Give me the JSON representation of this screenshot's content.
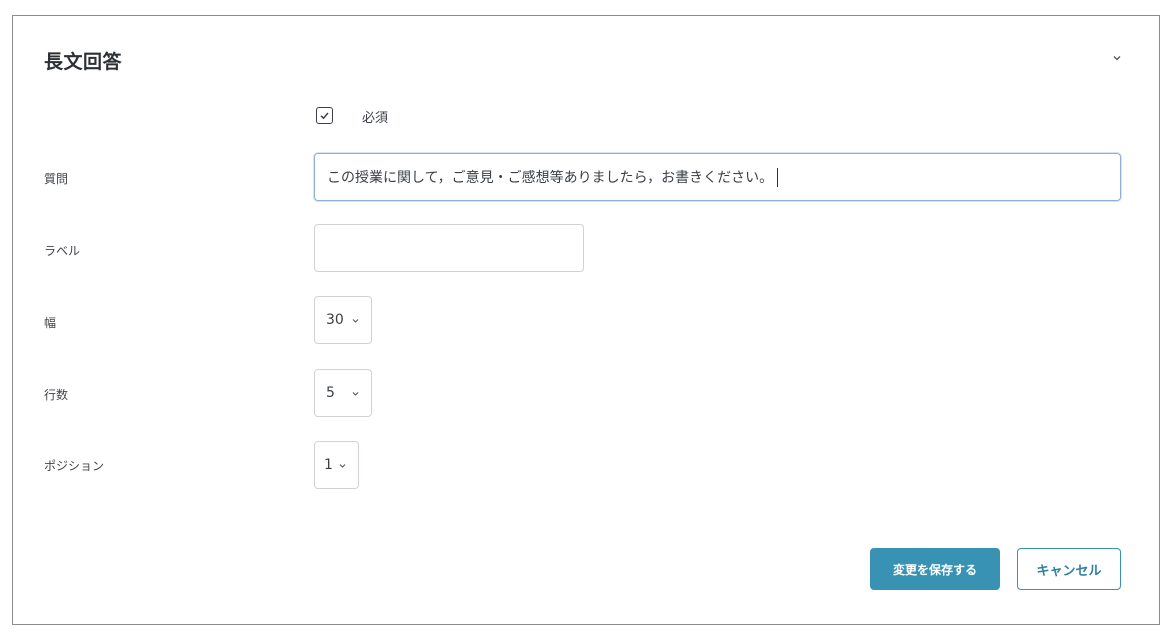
{
  "header": {
    "title": "長文回答",
    "collapse_icon": "chevron-down-icon"
  },
  "required": {
    "checked": true,
    "label": "必須"
  },
  "fields": {
    "question": {
      "label": "質問",
      "value": "この授業に関して，ご意見・ご感想等ありましたら，お書きください。"
    },
    "label": {
      "label": "ラベル",
      "value": ""
    },
    "width": {
      "label": "幅",
      "value": "30"
    },
    "rows": {
      "label": "行数",
      "value": "5"
    },
    "position": {
      "label": "ポジション",
      "value": "1"
    }
  },
  "actions": {
    "save_label": "変更を保存する",
    "cancel_label": "キャンセル"
  },
  "colors": {
    "accent": "#3792b4",
    "focus_border": "#8fb0d6",
    "panel_border": "#8d8d8d"
  }
}
